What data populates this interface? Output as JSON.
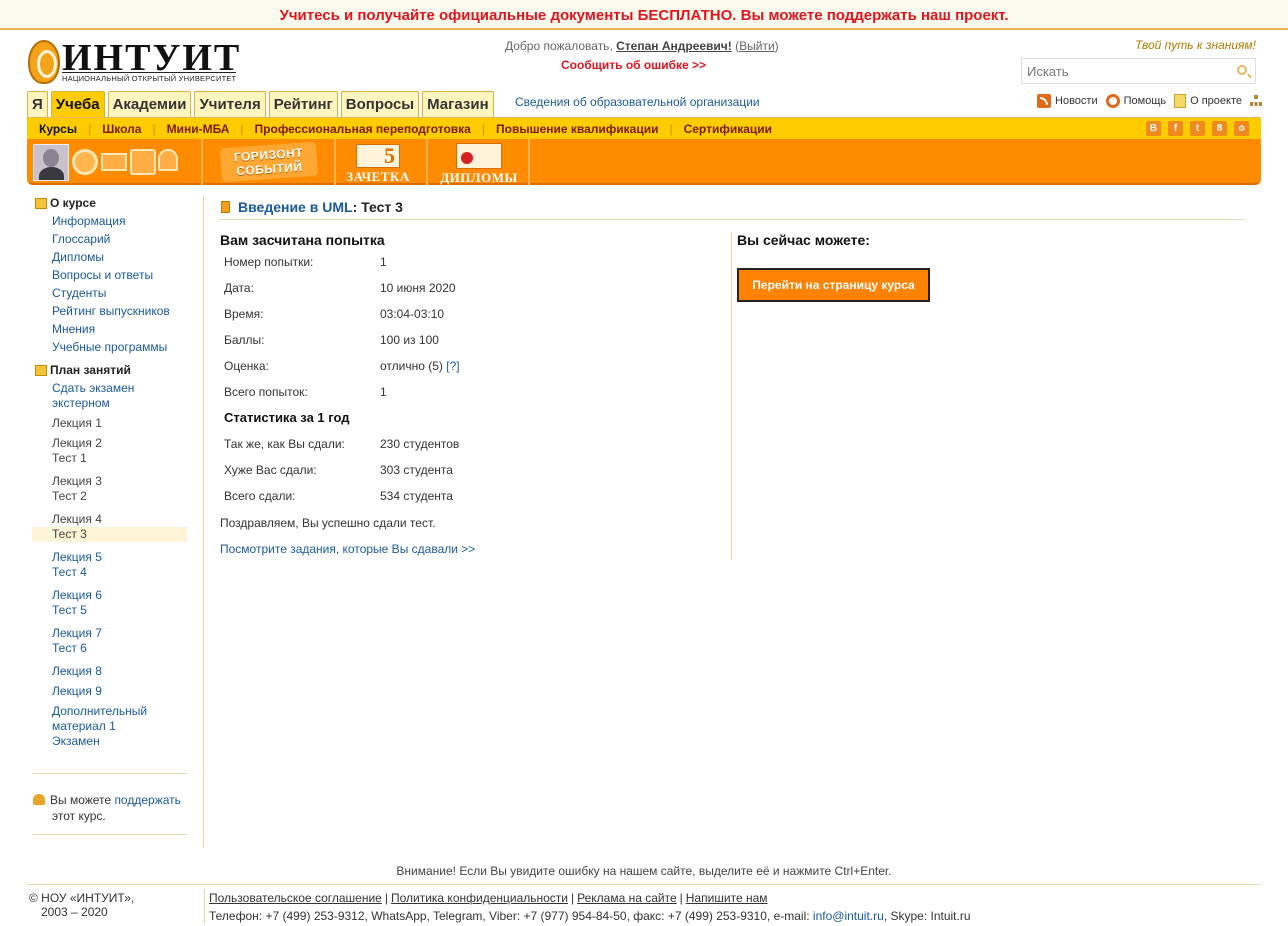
{
  "promo": {
    "text": "Учитесь и получайте официальные документы БЕСПЛАТНО. Вы можете поддержать наш проект."
  },
  "header": {
    "logo_word": "ИНТУИТ",
    "logo_sub": "НАЦИОНАЛЬНЫЙ ОТКРЫТЫЙ УНИВЕРСИТЕТ",
    "welcome_prefix": "Добро пожаловать,",
    "user_name": "Степан Андреевич!",
    "logout_open": "(",
    "logout": "Выйти",
    "logout_close": ")",
    "report_error": "Сообщить об ошибке >>",
    "slogan": "Твой путь к знаниям!",
    "search_placeholder": "Искать"
  },
  "tabs": [
    {
      "label": "Я"
    },
    {
      "label": "Учеба"
    },
    {
      "label": "Академии"
    },
    {
      "label": "Учителя"
    },
    {
      "label": "Рейтинг"
    },
    {
      "label": "Вопросы"
    },
    {
      "label": "Магазин"
    }
  ],
  "org_link": "Сведения об образовательной организации",
  "toplinks": {
    "news": "Новости",
    "help": "Помощь",
    "about": "О проекте"
  },
  "subnav": [
    "Курсы",
    "Школа",
    "Мини-МБА",
    "Профессиональная переподготовка",
    "Повышение квалификации",
    "Сертификации"
  ],
  "social": [
    "В",
    "f",
    "t",
    "8",
    "о"
  ],
  "toolbar": {
    "horizon_line1": "ГОРИЗОНТ",
    "horizon_line2": "СОБЫТИЙ",
    "zachetka": "ЗАЧЕТКА",
    "diplomy": "ДИПЛОМЫ"
  },
  "sidebar": {
    "about_title": "О курсе",
    "about_items": [
      "Информация",
      "Глоссарий",
      "Дипломы",
      "Вопросы и ответы",
      "Студенты",
      "Рейтинг выпускников",
      "Мнения",
      "Учебные программы"
    ],
    "plan_title": "План занятий",
    "plan_exam": [
      "Сдать экзамен",
      "экстерном"
    ],
    "lecture1": "Лекция 1",
    "l2": [
      "Лекция 2",
      "Тест 1"
    ],
    "l3": [
      "Лекция 3",
      "Тест 2"
    ],
    "l4": [
      "Лекция 4",
      "Тест 3"
    ],
    "l5": [
      "Лекция 5",
      "Тест 4"
    ],
    "l6": [
      "Лекция 6",
      "Тест 5"
    ],
    "l7": [
      "Лекция 7",
      "Тест 6"
    ],
    "lecture8": "Лекция 8",
    "lecture9": "Лекция 9",
    "extra": [
      "Дополнительный",
      "материал 1",
      "Экзамен"
    ],
    "support_prefix": "Вы можете ",
    "support_link": "поддержать",
    "support_suffix": "этот курс."
  },
  "main": {
    "course": "Введение в UML",
    "test_title": ": Тест 3",
    "result_title": "Вам засчитана попытка",
    "rows": [
      {
        "k": "Номер попытки:",
        "v": "1"
      },
      {
        "k": "Дата:",
        "v": "10 июня 2020"
      },
      {
        "k": "Время:",
        "v": "03:04-03:10"
      },
      {
        "k": "Баллы:",
        "v": "100 из 100"
      },
      {
        "k": "Оценка:",
        "v": "отлично (5)",
        "link": "[?]"
      },
      {
        "k": "Всего попыток:",
        "v": "1"
      }
    ],
    "stat_title": "Статистика за 1 год",
    "stat_rows": [
      {
        "k": "Так же, как Вы сдали:",
        "v": "230 студентов"
      },
      {
        "k": "Хуже Вас сдали:",
        "v": "303 студента"
      },
      {
        "k": "Всего сдали:",
        "v": "534 студента"
      }
    ],
    "congrats": "Поздравляем, Вы успешно сдали тест.",
    "view_link": "Посмотрите задания, которые Вы сдавали >>",
    "right_title": "Вы сейчас можете:",
    "go_button": "Перейти на страницу курса"
  },
  "footer": {
    "notice": "Внимание! Если Вы увидите ошибку на нашем сайте, выделите её и нажмите Ctrl+Enter.",
    "copyright": "© НОУ «ИНТУИТ»,",
    "years": "2003 – 2020",
    "links": [
      "Пользовательское соглашение",
      "Политика конфиденциальности",
      "Реклама на сайте",
      "Напишите нам"
    ],
    "contacts": "Телефон: +7 (499) 253-9312, WhatsApp, Telegram, Viber: +7 (977) 954-84-50, факс: +7 (499) 253-9310, e-mail: ",
    "email": "info@intuit.ru",
    "skype": ", Skype: Intuit.ru"
  }
}
